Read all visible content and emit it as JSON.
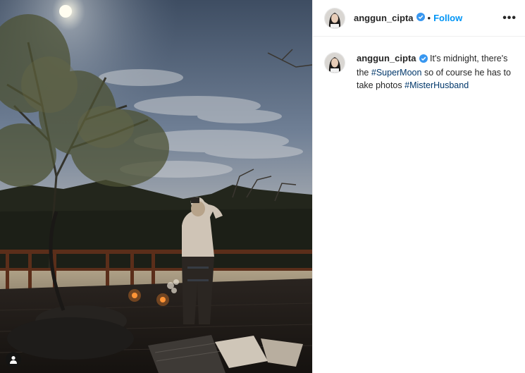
{
  "post": {
    "username": "anggun_cipta",
    "separator": "•",
    "follow_label": "Follow",
    "more_label": "•••"
  },
  "caption": {
    "username": "anggun_cipta",
    "text_part1": "It's midnight, there's the",
    "hashtag1": "#SuperMoon",
    "text_part2": "so of course he has to take photos",
    "hashtag2": "#MisterHusband"
  },
  "icons": {
    "verified": "verified-badge-icon",
    "user_tag": "user-tag-icon",
    "more": "more-options-icon"
  },
  "colors": {
    "link_blue": "#0095f6",
    "hashtag": "#00376b",
    "verified": "#3897f0"
  }
}
